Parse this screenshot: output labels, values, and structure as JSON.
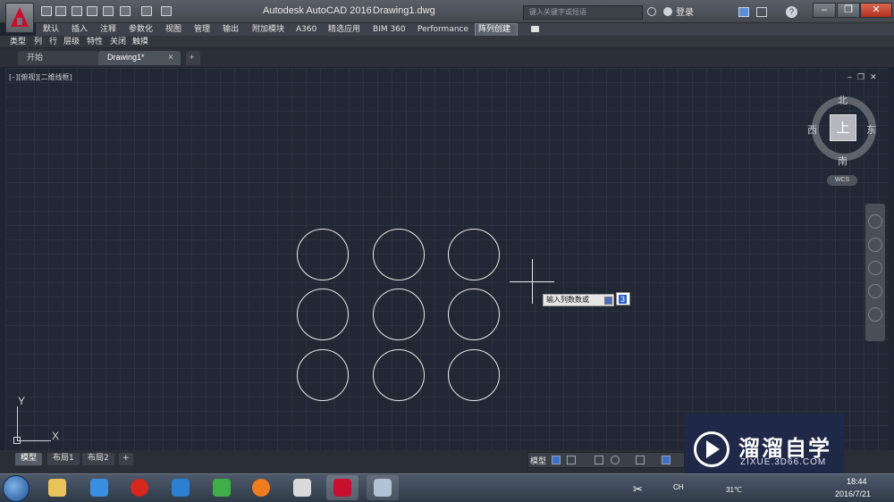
{
  "window": {
    "app_title": "Autodesk AutoCAD 2016",
    "document_title": "Drawing1.dwg",
    "search_placeholder": "键入关键字或短语",
    "login_label": "登录",
    "minimize": "–",
    "restore": "❐",
    "close": "✕"
  },
  "ribbon": {
    "tabs": [
      {
        "label": "默认"
      },
      {
        "label": "插入"
      },
      {
        "label": "注释"
      },
      {
        "label": "参数化"
      },
      {
        "label": "视图"
      },
      {
        "label": "管理"
      },
      {
        "label": "输出"
      },
      {
        "label": "附加模块"
      },
      {
        "label": "A360"
      },
      {
        "label": "精选应用"
      },
      {
        "label": "BIM 360"
      },
      {
        "label": "Performance"
      },
      {
        "label": "阵列创建"
      }
    ],
    "active_tab": "阵列创建",
    "panels": [
      {
        "label": "类型"
      },
      {
        "label": "列"
      },
      {
        "label": "行"
      },
      {
        "label": "层级"
      },
      {
        "label": "特性"
      },
      {
        "label": "关闭"
      },
      {
        "label": "触摸"
      }
    ]
  },
  "file_tabs": {
    "start": "开始",
    "drawing": "Drawing1*",
    "close_glyph": "×",
    "new": "+"
  },
  "viewport": {
    "label": "[–][俯视][二维线框]",
    "viewcube": {
      "top": "上",
      "north": "北",
      "south": "南",
      "east": "东",
      "west": "西",
      "wcs": "WCS"
    },
    "array": {
      "rows": 3,
      "columns": 3
    }
  },
  "command_prompt": {
    "text": "输入列数数或",
    "value": "3"
  },
  "ucs": {
    "x_label": "X",
    "y_label": "Y"
  },
  "layout_tabs": {
    "model": "模型",
    "layout1": "布局1",
    "layout2": "布局2",
    "add": "+"
  },
  "status": {
    "model_label": "模型"
  },
  "taskbar": {
    "language": "CH",
    "temperature": "31℃",
    "time": "18:44",
    "date": "2016/7/21"
  },
  "watermark": {
    "brand_cn": "溜溜自学",
    "url": "ZIXUE.3D66.COM"
  },
  "colors": {
    "canvas": "#212833",
    "accent_red": "#c8102e",
    "watermark_bg": "#1f284a"
  }
}
